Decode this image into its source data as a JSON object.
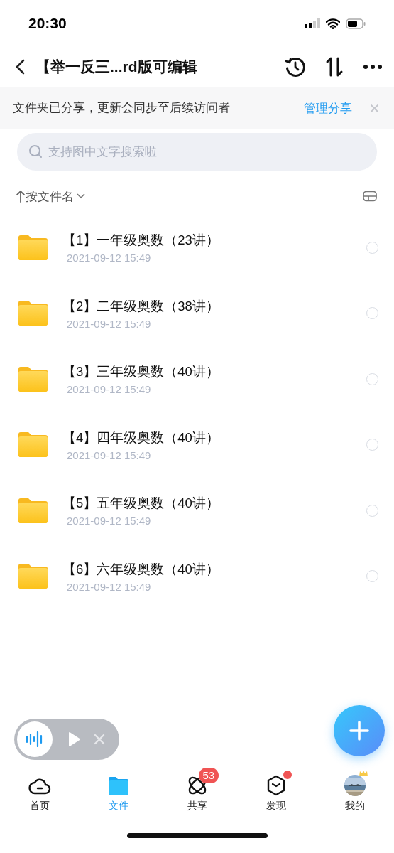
{
  "status_bar": {
    "time": "20:30"
  },
  "header": {
    "title": "【举一反三...rd版可编辑"
  },
  "banner": {
    "text": "文件夹已分享，更新会同步至后续访问者",
    "action": "管理分享"
  },
  "search": {
    "placeholder": "支持图中文字搜索啦"
  },
  "sort": {
    "label": "按文件名"
  },
  "files": [
    {
      "name": "【1】一年级奥数（23讲）",
      "date": "2021-09-12 15:49",
      "selected": false
    },
    {
      "name": "【2】二年级奥数（38讲）",
      "date": "2021-09-12 15:49",
      "selected": false
    },
    {
      "name": "【3】三年级奥数（40讲）",
      "date": "2021-09-12 15:49",
      "selected": false
    },
    {
      "name": "【4】四年级奥数（40讲）",
      "date": "2021-09-12 15:49",
      "selected": false
    },
    {
      "name": "【5】五年级奥数（40讲）",
      "date": "2021-09-12 15:49",
      "selected": false
    },
    {
      "name": "【6】六年级奥数（40讲）",
      "date": "2021-09-12 15:49",
      "selected": false
    }
  ],
  "tabs": [
    {
      "kind": "home",
      "label": "首页",
      "selected": false,
      "dot": false
    },
    {
      "kind": "files",
      "label": "文件",
      "selected": true,
      "dot": false
    },
    {
      "kind": "share",
      "label": "共享",
      "selected": false,
      "badge": "53",
      "dot": false
    },
    {
      "kind": "discover",
      "label": "发现",
      "selected": false,
      "dot": true
    },
    {
      "kind": "profile",
      "label": "我的",
      "selected": false,
      "dot": false
    }
  ]
}
